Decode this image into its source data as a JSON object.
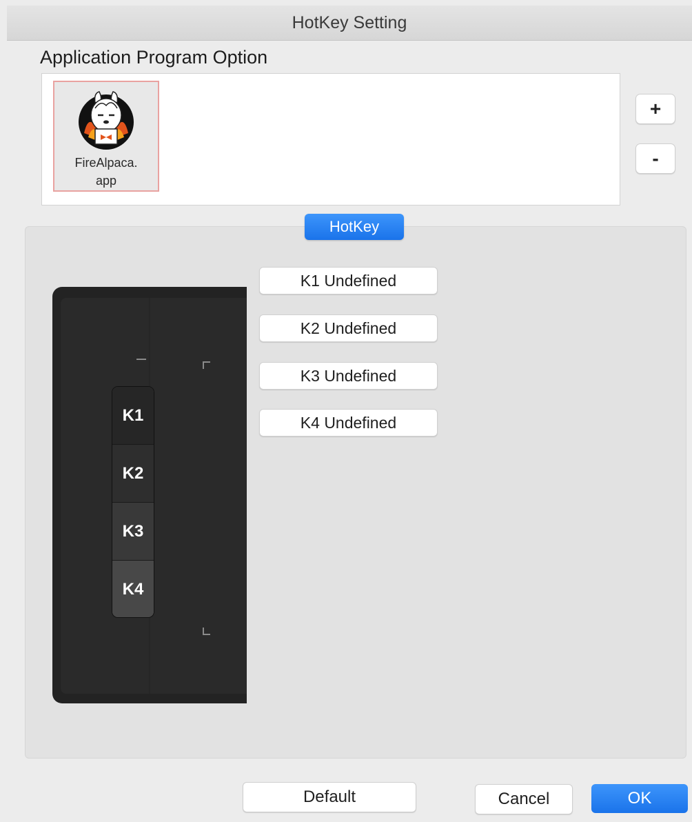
{
  "window": {
    "title": "HotKey Setting"
  },
  "app_section": {
    "label": "Application Program Option",
    "apps": [
      {
        "name": "FireAlpaca.\napp",
        "icon": "firealpaca-app-icon",
        "selected": true
      }
    ],
    "add_label": "+",
    "remove_label": "-"
  },
  "tab": {
    "label": "HotKey"
  },
  "device": {
    "keys": [
      "K1",
      "K2",
      "K3",
      "K4"
    ]
  },
  "hotkeys": [
    {
      "label": "K1 Undefined"
    },
    {
      "label": "K2 Undefined"
    },
    {
      "label": "K3 Undefined"
    },
    {
      "label": "K4 Undefined"
    }
  ],
  "footer": {
    "default_label": "Default",
    "cancel_label": "Cancel",
    "ok_label": "OK"
  },
  "colors": {
    "accent": "#1a73ea",
    "selection_border": "#e9a2a0",
    "device_body": "#232323"
  }
}
